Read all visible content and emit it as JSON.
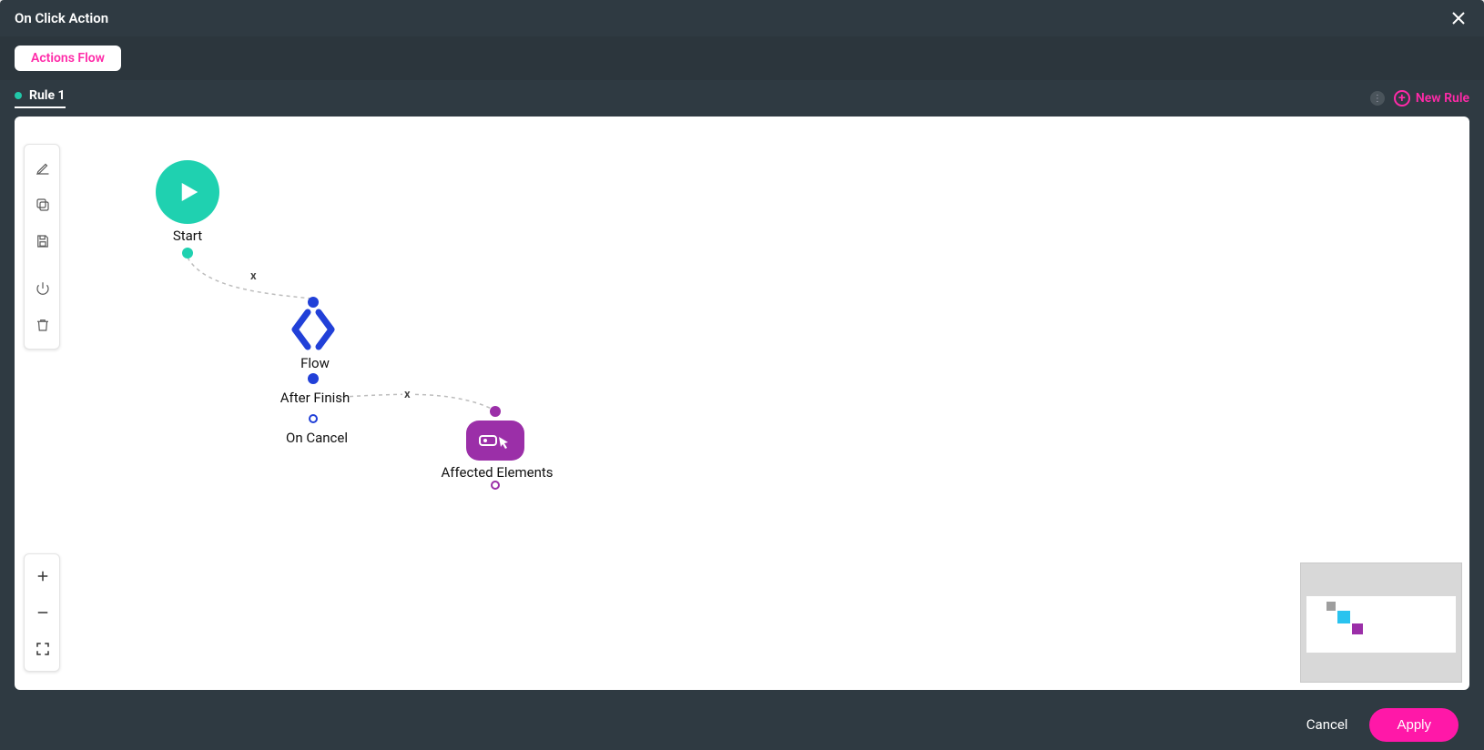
{
  "header": {
    "title": "On Click Action"
  },
  "tabs": {
    "actions_flow": "Actions Flow"
  },
  "rule_bar": {
    "active_rule": "Rule 1",
    "new_rule": "New Rule"
  },
  "nodes": {
    "start": {
      "label": "Start"
    },
    "flow": {
      "label": "Flow",
      "after_finish": "After Finish",
      "on_cancel": "On Cancel"
    },
    "affected": {
      "label": "Affected Elements"
    }
  },
  "edges": {
    "remove_glyph": "x"
  },
  "footer": {
    "cancel": "Cancel",
    "apply": "Apply"
  },
  "colors": {
    "accent_pink": "#ff18a8",
    "teal": "#1fd1b0",
    "blue": "#2140d8",
    "purple": "#9b2fa8",
    "panel": "#2f3a42"
  }
}
